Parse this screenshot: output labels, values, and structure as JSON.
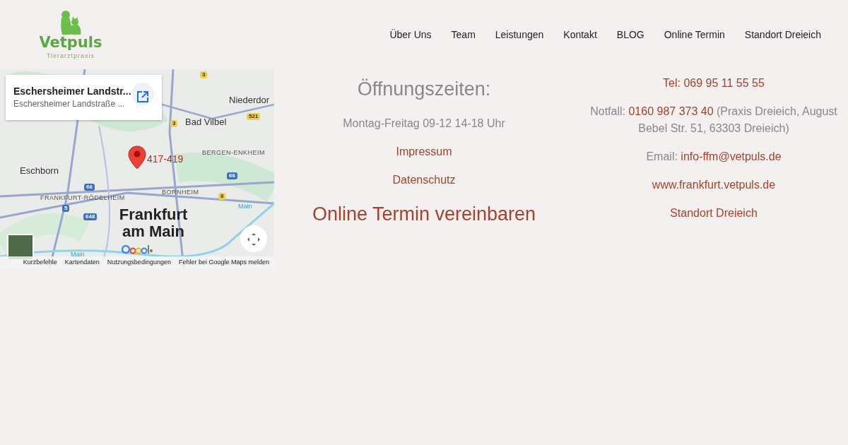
{
  "logo": {
    "name": "Vetpuls",
    "tagline": "Tierarztpraxis"
  },
  "nav": [
    {
      "label": "Über Uns"
    },
    {
      "label": "Team"
    },
    {
      "label": "Leistungen"
    },
    {
      "label": "Kontakt"
    },
    {
      "label": "BLOG"
    },
    {
      "label": "Online Termin"
    },
    {
      "label": "Standort Dreieich"
    }
  ],
  "map": {
    "place_title": "Eschersheimer Landstr...",
    "place_address": "Eschersheimer Landstraße ...",
    "pin_label": "417-419",
    "labels": [
      {
        "text": "Niederdor",
        "kind": "place"
      },
      {
        "text": "Bad Vilbel",
        "kind": "place"
      },
      {
        "text": "BERGEN-ENKHEIM",
        "kind": "district"
      },
      {
        "text": "Eschborn",
        "kind": "place"
      },
      {
        "text": "FRANKFURT-RÖDELHEIM",
        "kind": "district"
      },
      {
        "text": "BORNHEIM",
        "kind": "district"
      },
      {
        "text": "Frankfurt am Main",
        "kind": "city"
      },
      {
        "text": "Main",
        "kind": "water"
      },
      {
        "text": "Main",
        "kind": "water"
      },
      {
        "text": "3",
        "kind": "shield"
      },
      {
        "text": "3",
        "kind": "shield"
      },
      {
        "text": "521",
        "kind": "shield"
      },
      {
        "text": "66",
        "kind": "shield"
      },
      {
        "text": "66",
        "kind": "shield"
      },
      {
        "text": "5",
        "kind": "shield"
      },
      {
        "text": "648",
        "kind": "shield"
      },
      {
        "text": "8",
        "kind": "shield"
      }
    ],
    "footer_links": [
      "Kurzbefehle",
      "Kartendaten",
      "Nutzungsbedingungen",
      "Fehler bei Google Maps melden"
    ]
  },
  "hours": {
    "title": "Öffnungszeiten:",
    "text": "Montag-Freitag 09-12 14-18 Uhr",
    "links": [
      "Impressum",
      "Datenschutz"
    ],
    "cta": "Online Termin vereinbaren"
  },
  "contact": {
    "phone": "Tel: 069 95 11 55 55",
    "emergency_label": "Notfall:",
    "emergency_number": "0160 987 373 40",
    "emergency_note": "(Praxis Dreieich, August Bebel Str. 51, 63303 Dreieich)",
    "email_label": "Email:",
    "email": "info-ffm@vetpuls.de",
    "website": "www.frankfurt.vetpuls.de",
    "location_link": "Standort Dreieich"
  }
}
